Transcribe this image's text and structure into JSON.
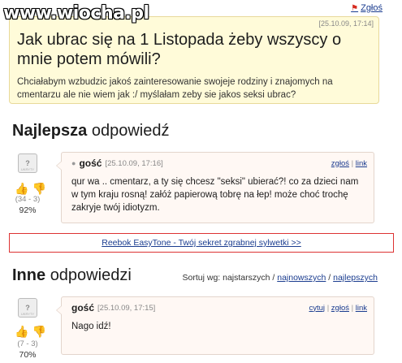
{
  "watermark": "www.wiocha.pl",
  "report_link": "Zgłoś",
  "question": {
    "date": "[25.10.09, 17:14]",
    "title": "Jak ubrac się na 1 Listopada żeby wszyscy o mnie potem mówili?",
    "description": "Chciałabym wzbudzic jakoś zainteresowanie swojeje rodziny i znajomych na cmentarzu ale nie wiem jak :/ myślałam zeby sie jakos seksi ubrac?"
  },
  "best_section": {
    "title_bold": "Najlepsza",
    "title_rest": "odpowiedź"
  },
  "best_answer": {
    "author": "gość",
    "date": "[25.10.09, 17:16]",
    "actions": {
      "report": "zgłoś",
      "separator": "|",
      "link": "link"
    },
    "text": "qur wa .. cmentarz, a ty się chcesz \"seksi\" ubierać?! co za dzieci nam w tym kraju rosną! załóż papierową tobrę na łep! może choć trochę zakryje twój idiotyzm.",
    "votes": "(34 - 3)",
    "percent": "92%"
  },
  "ad": {
    "text": "Reebok EasyTone - Twój sekret zgrabnej sylwetki >>"
  },
  "other_section": {
    "title_bold": "Inne",
    "title_rest": "odpowiedzi",
    "sort_label": "Sortuj wg: najstarszych /",
    "sort_newest": "najnowszych",
    "sort_sep": "/",
    "sort_best": "najlepszych"
  },
  "other_answer": {
    "author": "gość",
    "date": "[25.10.09, 17:15]",
    "actions": {
      "quote": "cytuj",
      "separator": "|",
      "report": "zgłoś",
      "link": "link"
    },
    "text": "Nago idź!",
    "votes": "(7 - 3)",
    "percent": "70%"
  },
  "icons": {
    "avatar": "anon-avatar-icon",
    "thumb_up": "thumb-up-icon",
    "thumb_down": "thumb-down-icon",
    "flag": "flag-icon"
  },
  "colors": {
    "question_bg": "#fffbd9",
    "answer_bg": "#fff8f4",
    "link": "#1a3c8f",
    "ad_border": "#dd3333",
    "thumb_up": "#c2399d",
    "thumb_down": "#e4a01a"
  }
}
